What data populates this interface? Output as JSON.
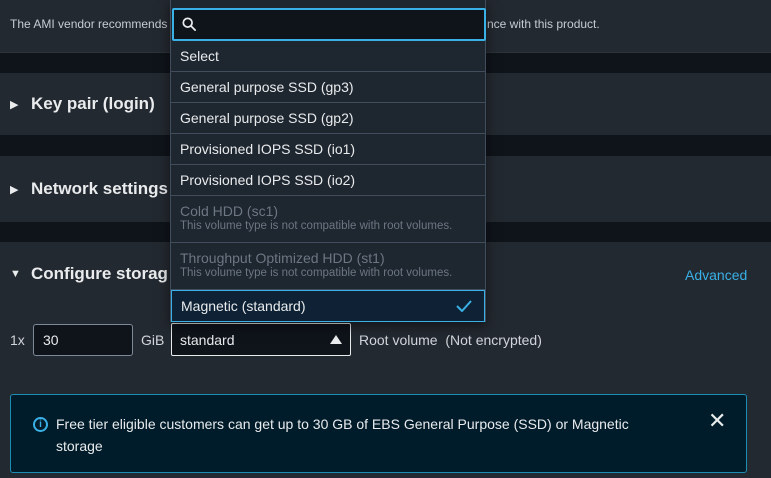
{
  "top_notice": {
    "left_text": "The AMI vendor recommends",
    "right_text": "nce with this product."
  },
  "sections": {
    "key_pair": {
      "title": "Key pair (login)"
    },
    "network": {
      "title": "Network settings"
    },
    "storage": {
      "title": "Configure storag",
      "advanced_label": "Advanced"
    }
  },
  "storage_row": {
    "multiplier_label": "1x",
    "size_value": "30",
    "unit_label": "GiB",
    "selected_type": "standard",
    "root_label": "Root volume  (Not encrypted)"
  },
  "dropdown": {
    "search_placeholder": "",
    "options": [
      {
        "label": "Select"
      },
      {
        "label": "General purpose SSD (gp3)"
      },
      {
        "label": "General purpose SSD (gp2)"
      },
      {
        "label": "Provisioned IOPS SSD (io1)"
      },
      {
        "label": "Provisioned IOPS SSD (io2)"
      },
      {
        "label": "Cold HDD (sc1)",
        "sub": "This volume type is not compatible with root volumes."
      },
      {
        "label": "Throughput Optimized HDD (st1)",
        "sub": "This volume type is not compatible with root volumes."
      },
      {
        "label": "Magnetic (standard)"
      }
    ]
  },
  "info_banner": {
    "text": "Free tier eligible customers can get up to 30 GB of EBS General Purpose (SSD) or Magnetic storage"
  },
  "colors": {
    "accent": "#39b0e6",
    "panel": "#232930",
    "background": "#0f141a"
  }
}
